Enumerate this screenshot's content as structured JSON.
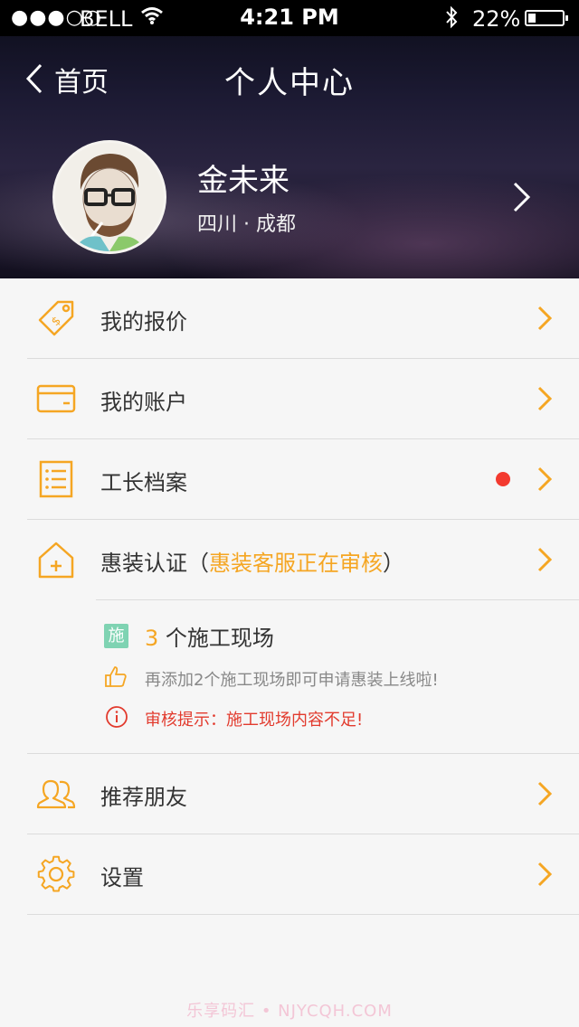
{
  "status_bar": {
    "signal": "●●●○○",
    "carrier": "BELL",
    "time": "4:21 PM",
    "battery": "22%",
    "battery_level": 0.22
  },
  "nav": {
    "back_label": "首页",
    "title": "个人中心"
  },
  "profile": {
    "name": "金未来",
    "location": "四川 · 成都"
  },
  "menu": {
    "items": [
      {
        "label": "我的报价",
        "icon": "price-tag-icon"
      },
      {
        "label": "我的账户",
        "icon": "card-icon"
      },
      {
        "label": "工长档案",
        "icon": "list-doc-icon",
        "has_dot": true
      },
      {
        "label_prefix": "惠装认证（",
        "label_highlight": "惠装客服正在审核",
        "label_suffix": "）",
        "icon": "house-plus-icon"
      },
      {
        "label": "推荐朋友",
        "icon": "friends-icon"
      },
      {
        "label": "设置",
        "icon": "gear-icon"
      }
    ]
  },
  "sites": {
    "badge": "施",
    "count": "3",
    "count_suffix": " 个施工现场",
    "tip": "再添加2个施工现场即可申请惠装上线啦!",
    "warning": "审核提示：施工现场内容不足!"
  },
  "watermark": "乐享码汇 • NJYCQH.COM",
  "colors": {
    "accent": "#f5a623",
    "dot": "#f33a2f",
    "warning": "#e23b2e",
    "badge": "#7fd3b2"
  }
}
